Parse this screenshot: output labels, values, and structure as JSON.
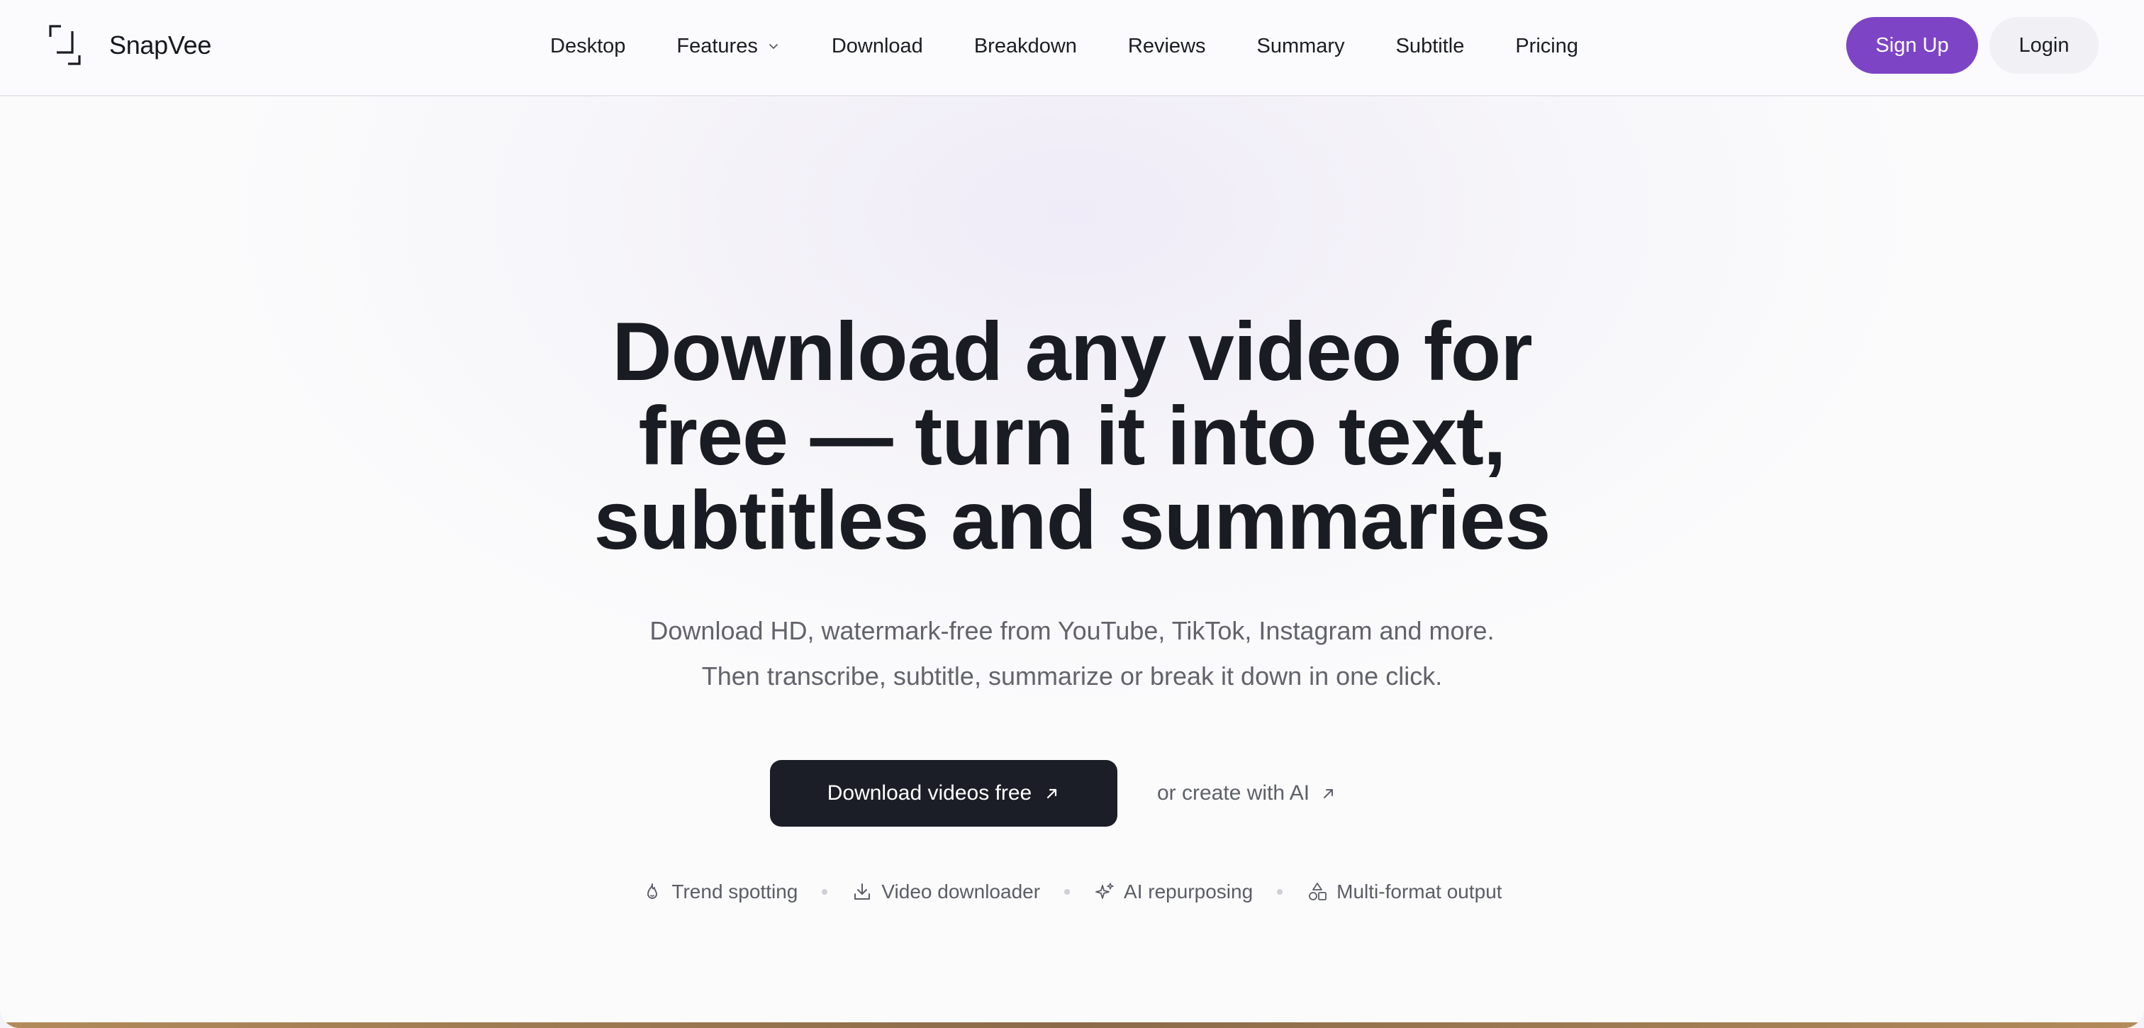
{
  "brand": {
    "name": "SnapVee",
    "accent": "#7e44c6",
    "dark": "#1b1e26"
  },
  "nav": {
    "links": [
      {
        "label": "Desktop"
      },
      {
        "label": "Features",
        "has_dropdown": true
      },
      {
        "label": "Download"
      },
      {
        "label": "Breakdown"
      },
      {
        "label": "Reviews"
      },
      {
        "label": "Summary"
      },
      {
        "label": "Subtitle"
      },
      {
        "label": "Pricing"
      }
    ],
    "signup_label": "Sign Up",
    "login_label": "Login"
  },
  "hero": {
    "title_line1": "Download any video for",
    "title_line2": "free — turn it into text,",
    "title_line3": "subtitles and summaries",
    "subtitle_line1": "Download HD, watermark-free from YouTube, TikTok, Instagram and more.",
    "subtitle_line2": "Then transcribe, subtitle, summarize or break it down in one click.",
    "primary_cta": "Download videos free",
    "secondary_cta": "or create with AI"
  },
  "features": [
    {
      "icon": "flame-icon",
      "label": "Trend spotting"
    },
    {
      "icon": "download-icon",
      "label": "Video downloader"
    },
    {
      "icon": "sparkles-icon",
      "label": "AI repurposing"
    },
    {
      "icon": "shapes-icon",
      "label": "Multi-format output"
    }
  ]
}
